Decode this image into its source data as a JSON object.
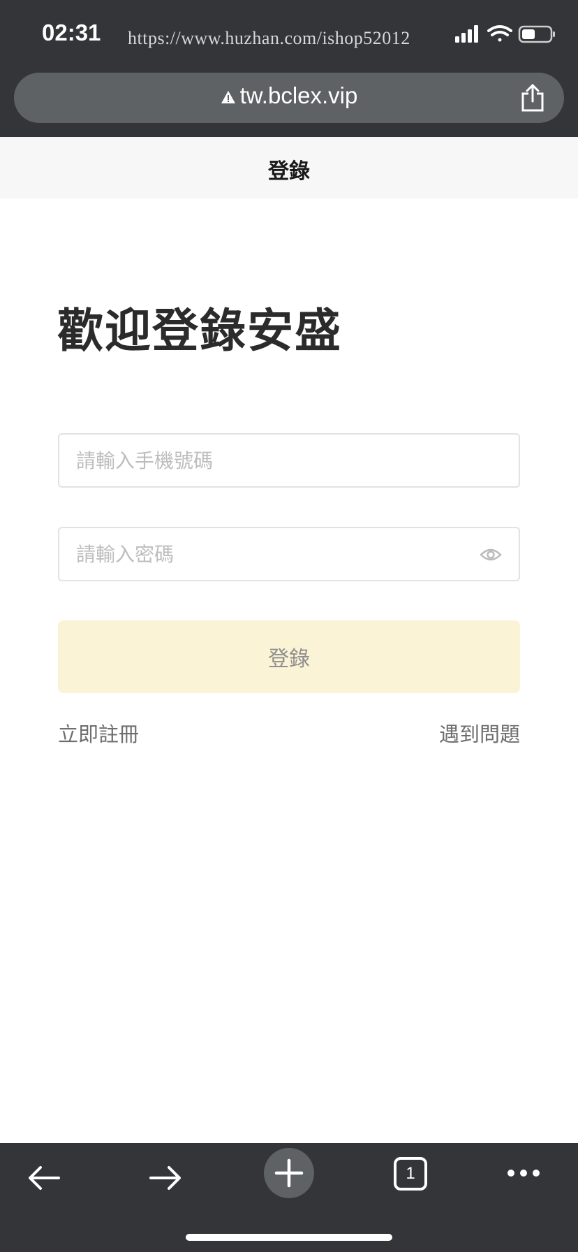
{
  "status_bar": {
    "time": "02:31",
    "watermark": "https://www.huzhan.com/ishop52012"
  },
  "browser": {
    "url": "tw.bclex.vip",
    "tab_count": "1",
    "icons": [
      "warning-icon",
      "share-icon",
      "back-arrow-icon",
      "forward-arrow-icon",
      "plus-icon",
      "tabs-icon",
      "more-icon"
    ]
  },
  "header": {
    "title": "登錄"
  },
  "main": {
    "welcome": "歡迎登錄安盛",
    "phone_placeholder": "請輸入手機號碼",
    "password_placeholder": "請輸入密碼",
    "login_button": "登錄",
    "register_link": "立即註冊",
    "problem_link": "遇到問題"
  },
  "colors": {
    "browser_chrome": "#333538",
    "url_bar": "#5f6265",
    "login_button_bg": "#fbf3d6"
  }
}
